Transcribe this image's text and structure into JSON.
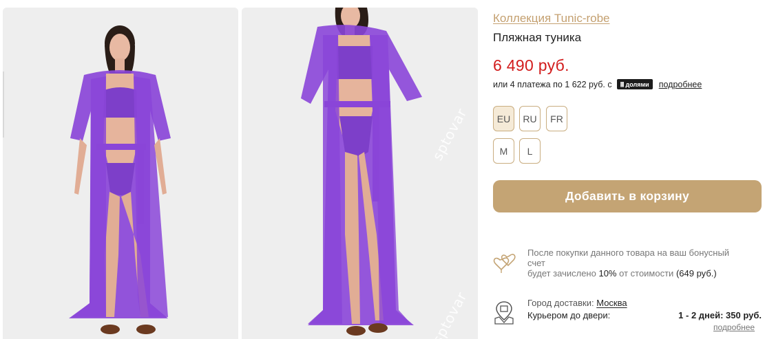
{
  "gallery": {
    "watermark": "sptovar"
  },
  "product": {
    "collection_link": "Коллекция Tunic-robe",
    "title": "Пляжная туника",
    "price": "6 490 руб.",
    "installments_text": "или 4 платежа по 1 622 руб. с",
    "installments_badge": "долями",
    "installments_more": "подробнее"
  },
  "size_systems": [
    "EU",
    "RU",
    "FR"
  ],
  "sizes": [
    "M",
    "L"
  ],
  "add_to_cart_label": "Добавить в корзину",
  "bonus": {
    "line1": "После покупки данного товара на ваш бонусный",
    "line2": "счет",
    "line3_prefix": "будет зачислено",
    "percent": "10%",
    "line3_mid": "от стоимости",
    "amount": "(649 руб.)"
  },
  "delivery": {
    "city_label": "Город доставки:",
    "city": "Москва",
    "courier_label": "Курьером до двери:",
    "courier_value": "1 - 2 дней: 350 руб.",
    "more": "подробнее"
  },
  "colors": {
    "accent": "#c4a474",
    "price": "#d21c1c",
    "tunic": "#8a45d8"
  }
}
